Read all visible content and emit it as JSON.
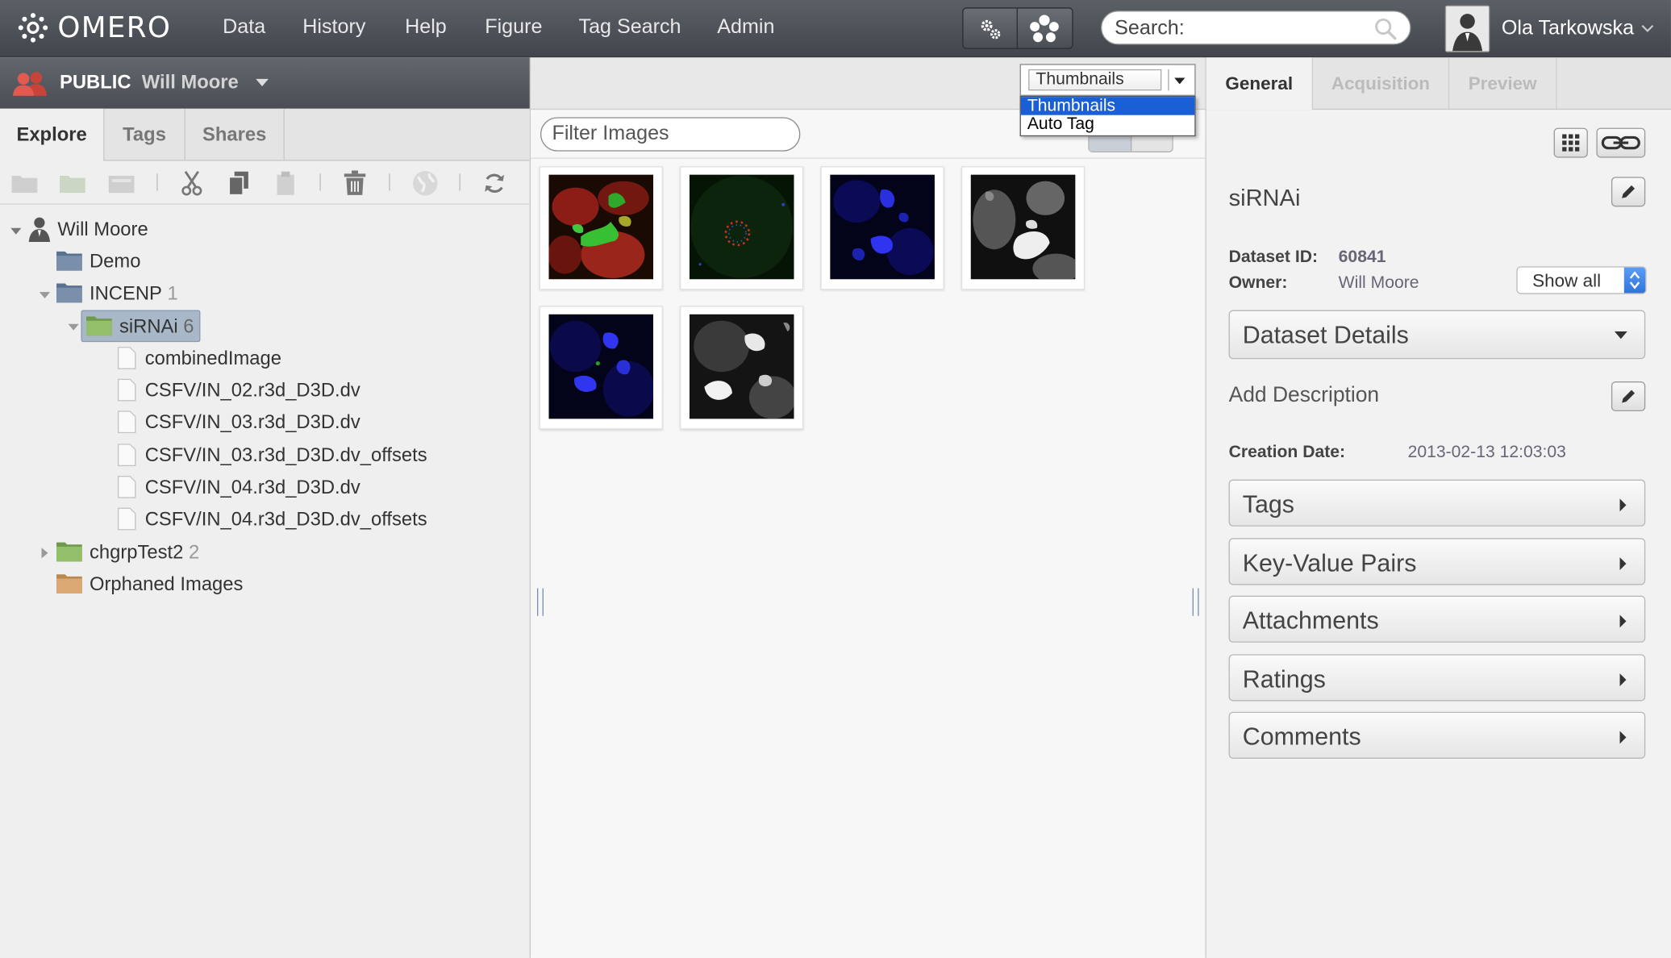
{
  "topbar": {
    "logo_text": "OMERO",
    "nav": [
      "Data",
      "History",
      "Help",
      "Figure",
      "Tag Search",
      "Admin"
    ],
    "search_placeholder": "Search:",
    "user_name": "Ola Tarkowska"
  },
  "left": {
    "group_name": "PUBLIC",
    "group_user": "Will Moore",
    "tabs": [
      "Explore",
      "Tags",
      "Shares"
    ],
    "active_tab": "Explore",
    "tree": {
      "root": "Will Moore",
      "nodes": [
        {
          "label": "Demo",
          "count": ""
        },
        {
          "label": "INCENP",
          "count": "1"
        },
        {
          "label": "siRNAi",
          "count": "6"
        },
        {
          "label": "combinedImage"
        },
        {
          "label": "CSFV/IN_02.r3d_D3D.dv"
        },
        {
          "label": "CSFV/IN_03.r3d_D3D.dv"
        },
        {
          "label": "CSFV/IN_03.r3d_D3D.dv_offsets"
        },
        {
          "label": "CSFV/IN_04.r3d_D3D.dv"
        },
        {
          "label": "CSFV/IN_04.r3d_D3D.dv_offsets"
        },
        {
          "label": "chgrpTest2",
          "count": "2"
        },
        {
          "label": "Orphaned Images"
        }
      ]
    }
  },
  "center": {
    "filter_placeholder": "Filter Images",
    "view_select": {
      "selected": "Thumbnails",
      "options": [
        "Thumbnails",
        "Auto Tag"
      ],
      "highlighted": "Thumbnails"
    },
    "thumbnail_count": 6
  },
  "right": {
    "tabs": [
      "General",
      "Acquisition",
      "Preview"
    ],
    "active_tab": "General",
    "dataset_name": "siRNAi",
    "dataset_id_label": "Dataset ID:",
    "dataset_id": "60841",
    "owner_label": "Owner:",
    "owner": "Will Moore",
    "show_all": "Show all",
    "dataset_details": "Dataset Details",
    "add_description": "Add Description",
    "creation_date_label": "Creation Date:",
    "creation_date": "2013-02-13 12:03:03",
    "sections": [
      "Tags",
      "Key-Value Pairs",
      "Attachments",
      "Ratings",
      "Comments"
    ]
  }
}
